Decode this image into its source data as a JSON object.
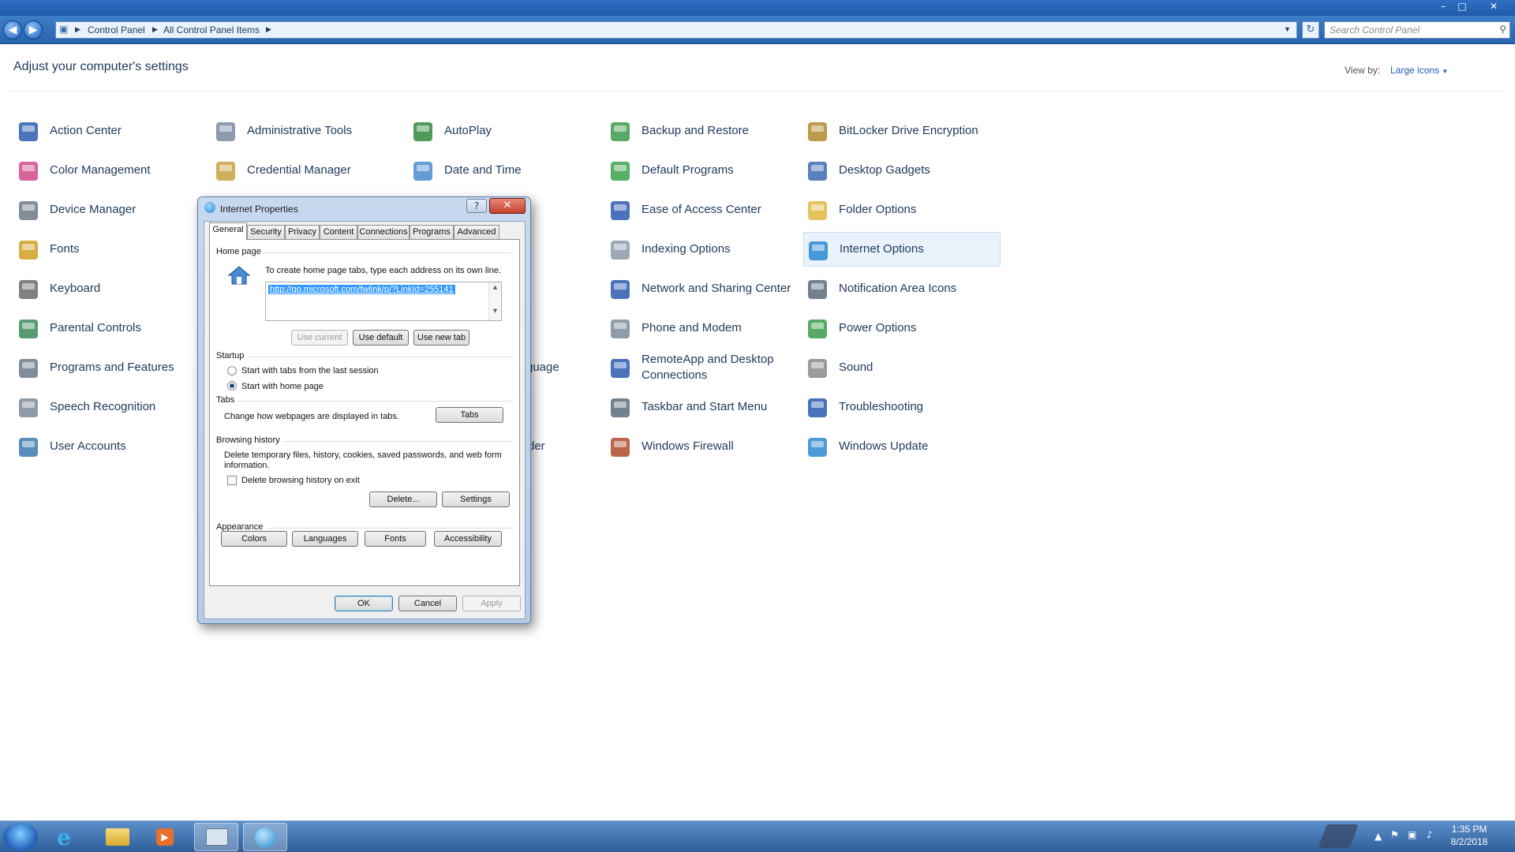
{
  "window": {
    "minimize": "–",
    "maximize": "□",
    "close": "✕"
  },
  "nav": {
    "back": "◀",
    "forward": "▶",
    "breadcrumb": [
      "Control Panel",
      "All Control Panel Items"
    ],
    "search_placeholder": "Search Control Panel"
  },
  "header": {
    "title": "Adjust your computer's settings",
    "view_by_label": "View by:",
    "view_by_value": "Large icons"
  },
  "items": [
    {
      "label": "Action Center",
      "icon": "flag-icon",
      "color": "#2a5db0"
    },
    {
      "label": "Administrative Tools",
      "icon": "admin-tools-icon",
      "color": "#7a8aa0"
    },
    {
      "label": "AutoPlay",
      "icon": "autoplay-icon",
      "color": "#2f8a3c"
    },
    {
      "label": "Backup and Restore",
      "icon": "backup-icon",
      "color": "#3a9a4a"
    },
    {
      "label": "BitLocker Drive Encryption",
      "icon": "key-icon",
      "color": "#b08a2a"
    },
    {
      "label": "Color Management",
      "icon": "color-management-icon",
      "color": "#d04a8a"
    },
    {
      "label": "Credential Manager",
      "icon": "credential-icon",
      "color": "#c8a040"
    },
    {
      "label": "Date and Time",
      "icon": "calendar-icon",
      "color": "#4a8ad0"
    },
    {
      "label": "Default Programs",
      "icon": "default-programs-icon",
      "color": "#3aa04a"
    },
    {
      "label": "Desktop Gadgets",
      "icon": "gadgets-icon",
      "color": "#3a6ab0"
    },
    {
      "label": "Device Manager",
      "icon": "device-manager-icon",
      "color": "#6a7a8a"
    },
    {
      "label": "Ease of Access Center",
      "icon": "accessibility-icon",
      "color": "#2a5ab0"
    },
    {
      "label": "Folder Options",
      "icon": "folder-icon",
      "color": "#e0b840"
    },
    {
      "label": "Fonts",
      "icon": "font-icon",
      "color": "#d0a020"
    },
    {
      "label": "Indexing Options",
      "icon": "indexing-icon",
      "color": "#8a9aaa"
    },
    {
      "label": "Internet Options",
      "icon": "globe-icon",
      "color": "#2a8ad0"
    },
    {
      "label": "Keyboard",
      "icon": "keyboard-icon",
      "color": "#6a6a6a"
    },
    {
      "label": "Network and Sharing Center",
      "icon": "network-icon",
      "color": "#2a5ab0"
    },
    {
      "label": "Notification Area Icons",
      "icon": "notification-icon",
      "color": "#5a6a7a"
    },
    {
      "label": "Parental Controls",
      "icon": "parental-icon",
      "color": "#3a8a5a"
    },
    {
      "label": "Phone and Modem",
      "icon": "phone-icon",
      "color": "#7a8a9a"
    },
    {
      "label": "Power Options",
      "icon": "power-icon",
      "color": "#3a9a4a"
    },
    {
      "label": "Programs and Features",
      "icon": "programs-icon",
      "color": "#6a7a8a"
    },
    {
      "label": "RemoteApp and Desktop Connections",
      "icon": "remote-icon",
      "color": "#2a5ab0"
    },
    {
      "label": "Sound",
      "icon": "speaker-icon",
      "color": "#8a8a8a"
    },
    {
      "label": "Speech Recognition",
      "icon": "microphone-icon",
      "color": "#7a8a9a"
    },
    {
      "label": "Taskbar and Start Menu",
      "icon": "taskbar-icon",
      "color": "#5a6a7a"
    },
    {
      "label": "Troubleshooting",
      "icon": "troubleshoot-icon",
      "color": "#2a5ab0"
    },
    {
      "label": "User Accounts",
      "icon": "user-icon",
      "color": "#3a7ab0"
    },
    {
      "label": "Windows Firewall",
      "icon": "firewall-icon",
      "color": "#b04a2a"
    },
    {
      "label": "Windows Update",
      "icon": "update-icon",
      "color": "#2a8ad0"
    }
  ],
  "behind_fragments": {
    "row9": "guage",
    "row11": "der"
  },
  "dialog": {
    "title": "Internet Properties",
    "help": "?",
    "close": "✕",
    "tabs": [
      "General",
      "Security",
      "Privacy",
      "Content",
      "Connections",
      "Programs",
      "Advanced"
    ],
    "home_page": {
      "group": "Home page",
      "instruction": "To create home page tabs, type each address on its own line.",
      "url": "http://go.microsoft.com/fwlink/p/?LinkId=255141",
      "use_current": "Use current",
      "use_default": "Use default",
      "use_new_tab": "Use new tab"
    },
    "startup": {
      "group": "Startup",
      "option1": "Start with tabs from the last session",
      "option2": "Start with home page"
    },
    "tabs_group": {
      "group": "Tabs",
      "desc": "Change how webpages are displayed in tabs.",
      "button": "Tabs"
    },
    "history": {
      "group": "Browsing history",
      "desc": "Delete temporary files, history, cookies, saved passwords, and web form information.",
      "checkbox": "Delete browsing history on exit",
      "delete": "Delete...",
      "settings": "Settings"
    },
    "appearance": {
      "group": "Appearance",
      "colors": "Colors",
      "languages": "Languages",
      "fonts": "Fonts",
      "accessibility": "Accessibility"
    },
    "ok": "OK",
    "cancel": "Cancel",
    "apply": "Apply"
  },
  "taskbar": {
    "time": "1:35 PM",
    "date": "8/2/2018"
  }
}
